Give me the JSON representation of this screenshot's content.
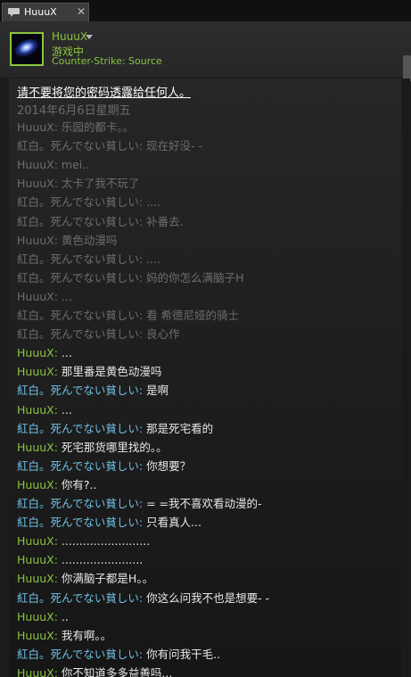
{
  "tab": {
    "title": "HuuuX"
  },
  "header": {
    "username": "HuuuX",
    "status": "游戏中",
    "game": "Counter-Strike: Source"
  },
  "chat": {
    "warning": "请不要将您的密码透露给任何人。",
    "date": "2014年6月6日星期五",
    "messages": [
      {
        "sender": "HuuuX",
        "text": "乐园的都卡。。",
        "self": true,
        "old": true
      },
      {
        "sender": "紅白。死んでない貧しい",
        "text": "现在好没- -",
        "self": false,
        "old": true
      },
      {
        "sender": "HuuuX",
        "text": "mei..",
        "self": true,
        "old": true
      },
      {
        "sender": "HuuuX",
        "text": "太卡了我不玩了",
        "self": true,
        "old": true
      },
      {
        "sender": "紅白。死んでない貧しい",
        "text": "....",
        "self": false,
        "old": true
      },
      {
        "sender": "紅白。死んでない貧しい",
        "text": "补番去.",
        "self": false,
        "old": true
      },
      {
        "sender": "HuuuX",
        "text": "黄色动漫吗",
        "self": true,
        "old": true
      },
      {
        "sender": "紅白。死んでない貧しい",
        "text": "....",
        "self": false,
        "old": true
      },
      {
        "sender": "紅白。死んでない貧しい",
        "text": "妈的你怎么满脑子H",
        "self": false,
        "old": true
      },
      {
        "sender": "HuuuX",
        "text": "...",
        "self": true,
        "old": true
      },
      {
        "sender": "紅白。死んでない貧しい",
        "text": "看 希德尼娅的骑士",
        "self": false,
        "old": true
      },
      {
        "sender": "紅白。死んでない貧しい",
        "text": "良心作",
        "self": false,
        "old": true
      },
      {
        "sender": "HuuuX",
        "text": "...",
        "self": true,
        "old": false
      },
      {
        "sender": "HuuuX",
        "text": "那里番是黄色动漫吗",
        "self": true,
        "old": false
      },
      {
        "sender": "紅白。死んでない貧しい",
        "text": "是啊",
        "self": false,
        "old": false
      },
      {
        "sender": "HuuuX",
        "text": "...",
        "self": true,
        "old": false
      },
      {
        "sender": "紅白。死んでない貧しい",
        "text": "那是死宅看的",
        "self": false,
        "old": false
      },
      {
        "sender": "HuuuX",
        "text": "死宅那货哪里找的。。",
        "self": true,
        "old": false
      },
      {
        "sender": "紅白。死んでない貧しい",
        "text": "你想要？",
        "self": false,
        "old": false
      },
      {
        "sender": "HuuuX",
        "text": "你有?..",
        "self": true,
        "old": false
      },
      {
        "sender": "紅白。死んでない貧しい",
        "text": "= =我不喜欢看动漫的-",
        "self": false,
        "old": false
      },
      {
        "sender": "紅白。死んでない貧しい",
        "text": "只看真人...",
        "self": false,
        "old": false
      },
      {
        "sender": "HuuuX",
        "text": ".........................",
        "self": true,
        "old": false
      },
      {
        "sender": "HuuuX",
        "text": ".......................",
        "self": true,
        "old": false
      },
      {
        "sender": "HuuuX",
        "text": "你满脑子都是H。。",
        "self": true,
        "old": false
      },
      {
        "sender": "紅白。死んでない貧しい",
        "text": "你这么问我不也是想要- -",
        "self": false,
        "old": false
      },
      {
        "sender": "HuuuX",
        "text": "..",
        "self": true,
        "old": false
      },
      {
        "sender": "HuuuX",
        "text": "我有啊。。",
        "self": true,
        "old": false
      },
      {
        "sender": "紅白。死んでない貧しい",
        "text": "你有问我干毛..",
        "self": false,
        "old": false
      },
      {
        "sender": "HuuuX",
        "text": "你不知道多多益善吗...",
        "self": true,
        "old": false
      }
    ]
  },
  "colors": {
    "self_name": "#8bc53f",
    "friend_name": "#6fc0e6",
    "old_text": "#6e6e6e",
    "new_text": "#e8e8e8"
  }
}
